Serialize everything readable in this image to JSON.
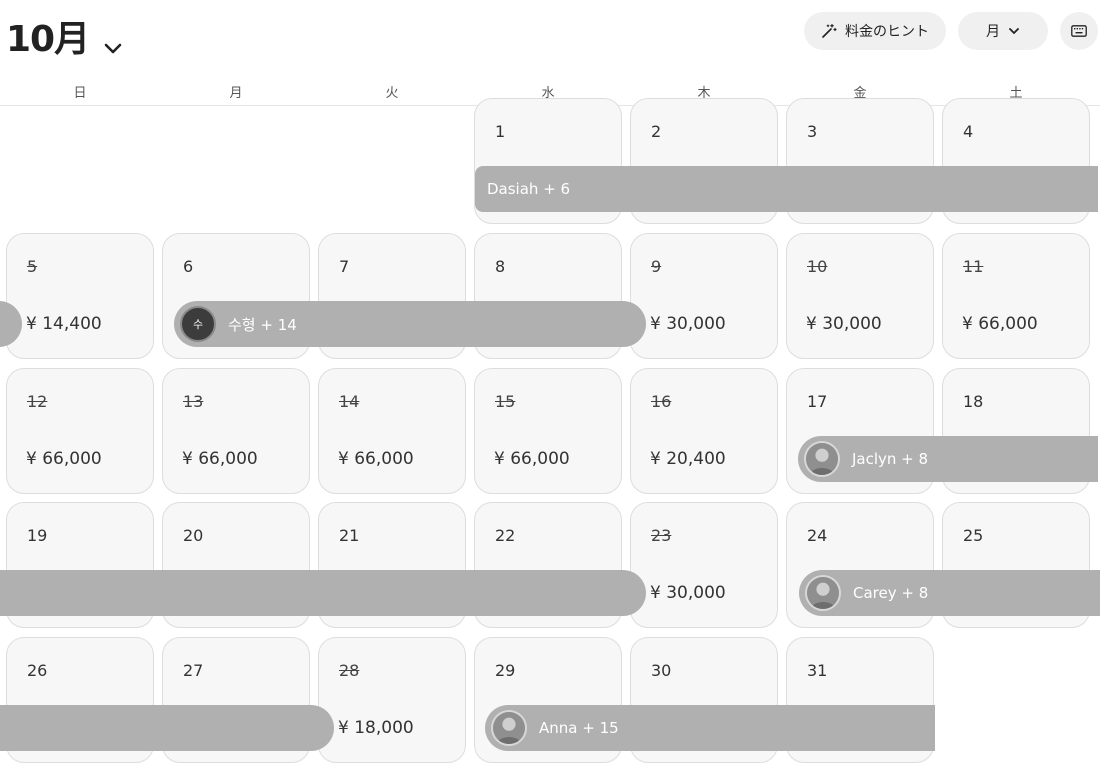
{
  "header": {
    "month_label": "10月",
    "hint_button_label": "料金のヒント",
    "view_button_label": "月"
  },
  "weekdays": [
    "日",
    "月",
    "火",
    "水",
    "木",
    "金",
    "土"
  ],
  "days": [
    {
      "day": "1",
      "price": "",
      "blocked": false
    },
    {
      "day": "2",
      "price": "",
      "blocked": false
    },
    {
      "day": "3",
      "price": "",
      "blocked": false
    },
    {
      "day": "4",
      "price": "",
      "blocked": false
    },
    {
      "day": "5",
      "price": "¥ 14,400",
      "blocked": true
    },
    {
      "day": "6",
      "price": "",
      "blocked": false
    },
    {
      "day": "7",
      "price": "",
      "blocked": false
    },
    {
      "day": "8",
      "price": "",
      "blocked": false
    },
    {
      "day": "9",
      "price": "¥ 30,000",
      "blocked": true
    },
    {
      "day": "10",
      "price": "¥ 30,000",
      "blocked": true
    },
    {
      "day": "11",
      "price": "¥ 66,000",
      "blocked": true
    },
    {
      "day": "12",
      "price": "¥ 66,000",
      "blocked": true
    },
    {
      "day": "13",
      "price": "¥ 66,000",
      "blocked": true
    },
    {
      "day": "14",
      "price": "¥ 66,000",
      "blocked": true
    },
    {
      "day": "15",
      "price": "¥ 66,000",
      "blocked": true
    },
    {
      "day": "16",
      "price": "¥ 20,400",
      "blocked": true
    },
    {
      "day": "17",
      "price": "",
      "blocked": false
    },
    {
      "day": "18",
      "price": "",
      "blocked": false
    },
    {
      "day": "19",
      "price": "",
      "blocked": false
    },
    {
      "day": "20",
      "price": "",
      "blocked": false
    },
    {
      "day": "21",
      "price": "",
      "blocked": false
    },
    {
      "day": "22",
      "price": "",
      "blocked": false
    },
    {
      "day": "23",
      "price": "¥ 30,000",
      "blocked": true
    },
    {
      "day": "24",
      "price": "",
      "blocked": false
    },
    {
      "day": "25",
      "price": "",
      "blocked": false
    },
    {
      "day": "26",
      "price": "",
      "blocked": false
    },
    {
      "day": "27",
      "price": "",
      "blocked": false
    },
    {
      "day": "28",
      "price": "¥ 18,000",
      "blocked": true
    },
    {
      "day": "29",
      "price": "",
      "blocked": false
    },
    {
      "day": "30",
      "price": "",
      "blocked": false
    },
    {
      "day": "31",
      "price": "",
      "blocked": false
    }
  ],
  "reservations": [
    {
      "guest_label": "Dasiah + 6",
      "avatar": ""
    },
    {
      "guest_label": "",
      "avatar": ""
    },
    {
      "guest_label": "수형 + 14",
      "avatar": "수"
    },
    {
      "guest_label": "Jaclyn + 8",
      "avatar": "photo"
    },
    {
      "guest_label": "",
      "avatar": ""
    },
    {
      "guest_label": "Carey + 8",
      "avatar": "photo"
    },
    {
      "guest_label": "",
      "avatar": ""
    },
    {
      "guest_label": "Anna + 15",
      "avatar": "photo"
    }
  ],
  "icons": {
    "month_dropdown": "chevron-down-icon",
    "hint": "magic-wand-icon",
    "view_dropdown": "chevron-down-icon",
    "keyboard": "keyboard-icon"
  },
  "colors": {
    "reservation_bar": "#b0b0b0",
    "cell_background": "#f7f7f7",
    "cell_border": "#dddddd"
  }
}
